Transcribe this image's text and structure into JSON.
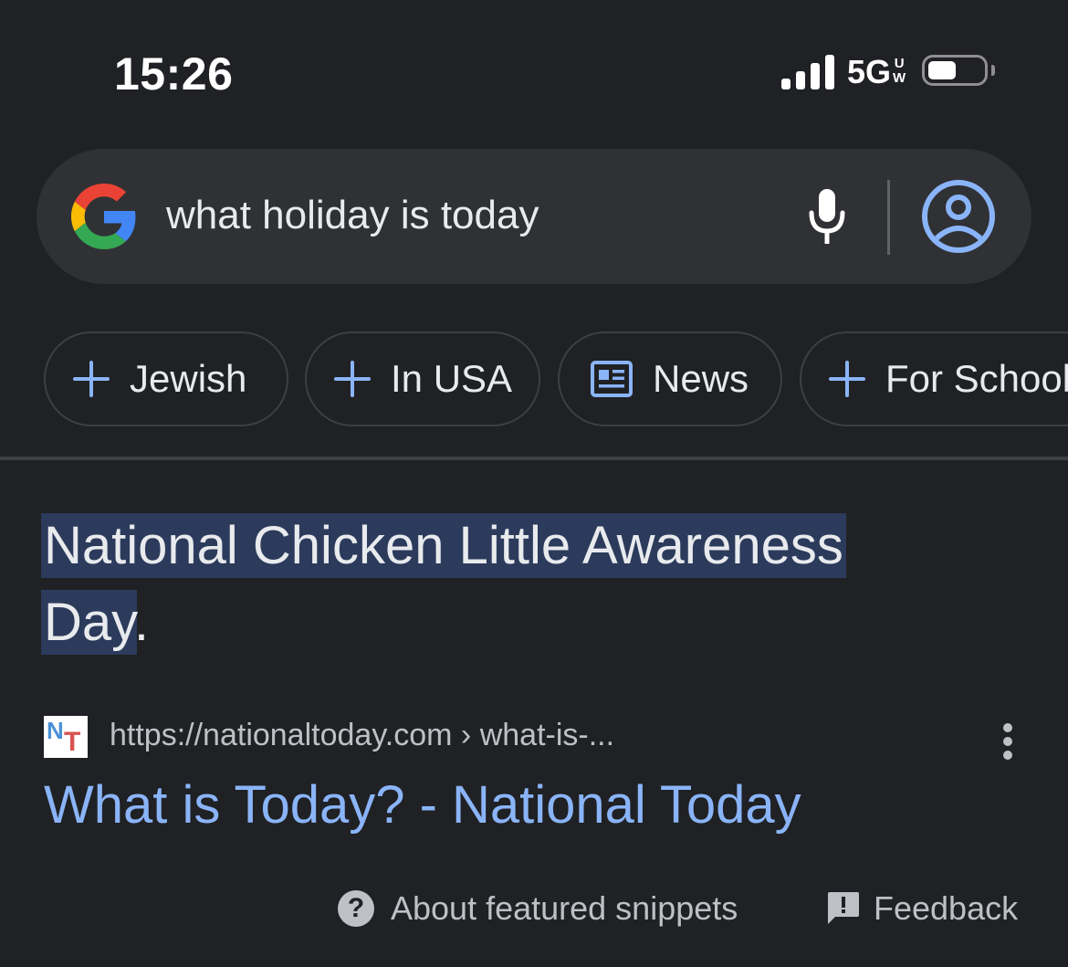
{
  "status_bar": {
    "time": "15:26",
    "network": "5G",
    "network_sup_top": "U",
    "network_sup_bottom": "W",
    "signal_icon": "cellular-signal-icon",
    "battery_icon": "battery-icon"
  },
  "search": {
    "query": "what holiday is today",
    "logo_icon": "google-g-icon",
    "mic_icon": "microphone-icon",
    "account_icon": "account-circle-icon"
  },
  "chips": [
    {
      "label": "Jewish",
      "icon": "plus-icon"
    },
    {
      "label": "In USA",
      "icon": "plus-icon"
    },
    {
      "label": "News",
      "icon": "newspaper-icon"
    },
    {
      "label": "For School",
      "icon": "plus-icon"
    }
  ],
  "featured_snippet": {
    "answer_part1": "National Chicken Little Awareness",
    "answer_part2": "Day",
    "answer_trailing": ".",
    "source_favicon_n": "N",
    "source_favicon_t": "T",
    "source_url": "https://nationaltoday.com › what-is-...",
    "result_title": "What is Today? - National Today",
    "more_icon": "more-vertical-icon"
  },
  "footer": {
    "about_label": "About featured snippets",
    "help_glyph": "?",
    "feedback_label": "Feedback"
  },
  "colors": {
    "background": "#202124",
    "search_bg": "#303134",
    "link": "#8ab4f8",
    "highlight": "#2c3b5c",
    "text": "#e8eaed",
    "secondary_text": "#bdc1c6"
  }
}
